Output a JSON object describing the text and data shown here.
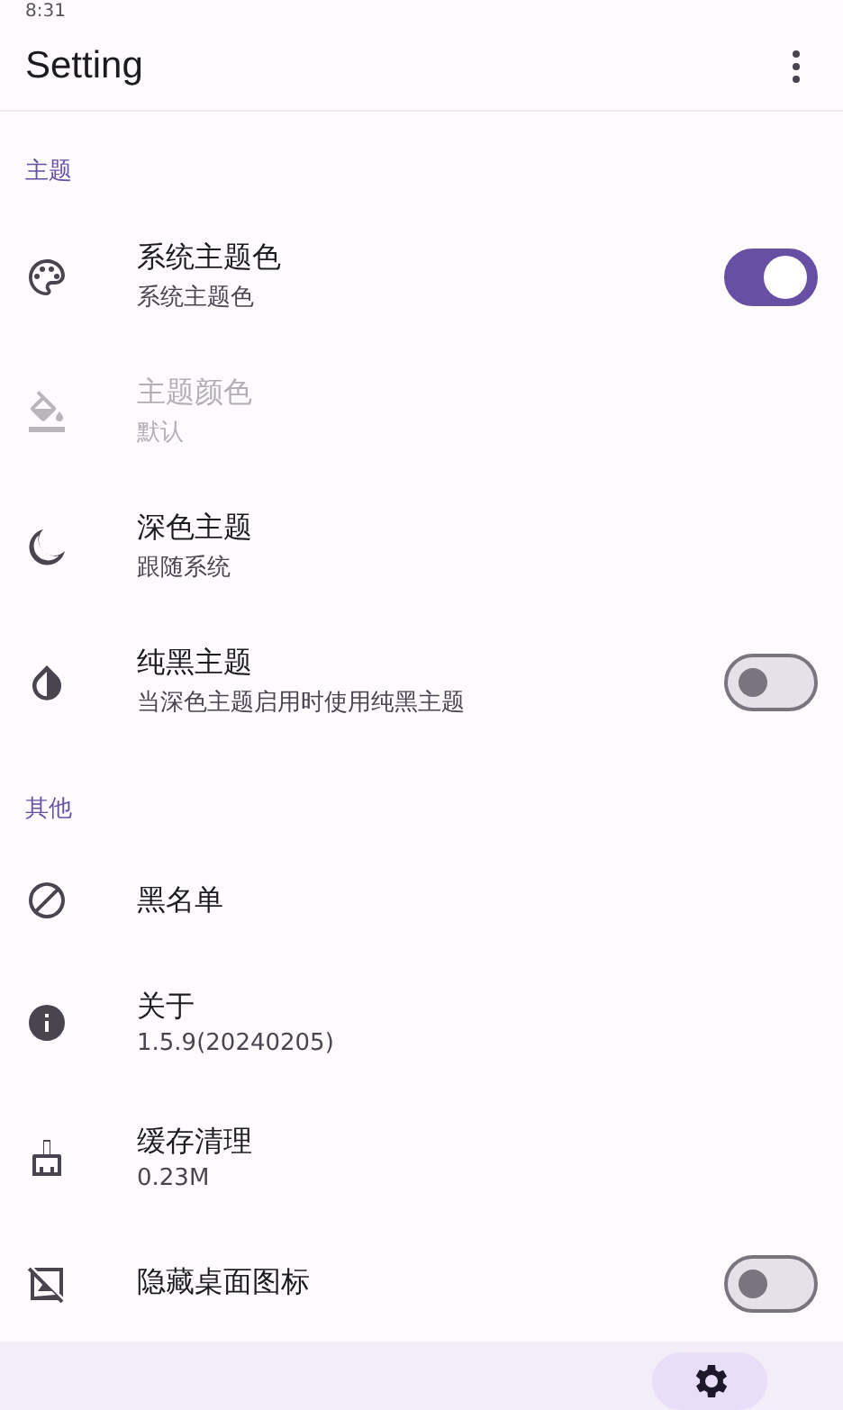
{
  "status_bar": {
    "time": "8:31"
  },
  "app_bar": {
    "title": "Setting"
  },
  "sections": [
    {
      "title": "主题",
      "items": [
        {
          "kind": "switch",
          "title": "系统主题色",
          "subtitle": "系统主题色",
          "disabled": false,
          "on": true
        },
        {
          "kind": "plain",
          "title": "主题颜色",
          "subtitle": "默认",
          "disabled": true
        },
        {
          "kind": "plain",
          "title": "深色主题",
          "subtitle": "跟随系统",
          "disabled": false
        },
        {
          "kind": "switch",
          "title": "纯黑主题",
          "subtitle": "当深色主题启用时使用纯黑主题",
          "disabled": false,
          "on": false
        }
      ]
    },
    {
      "title": "其他",
      "items": [
        {
          "kind": "plain",
          "title": "黑名单",
          "disabled": false
        },
        {
          "kind": "plain",
          "title": "关于",
          "subtitle": "1.5.9(20240205)",
          "disabled": false
        },
        {
          "kind": "plain",
          "title": "缓存清理",
          "subtitle": "0.23M",
          "disabled": false
        },
        {
          "kind": "switch",
          "title": "隐藏桌面图标",
          "disabled": false,
          "on": false
        }
      ]
    }
  ],
  "bottom_nav": {
    "items": [
      {
        "selected": true
      }
    ]
  }
}
